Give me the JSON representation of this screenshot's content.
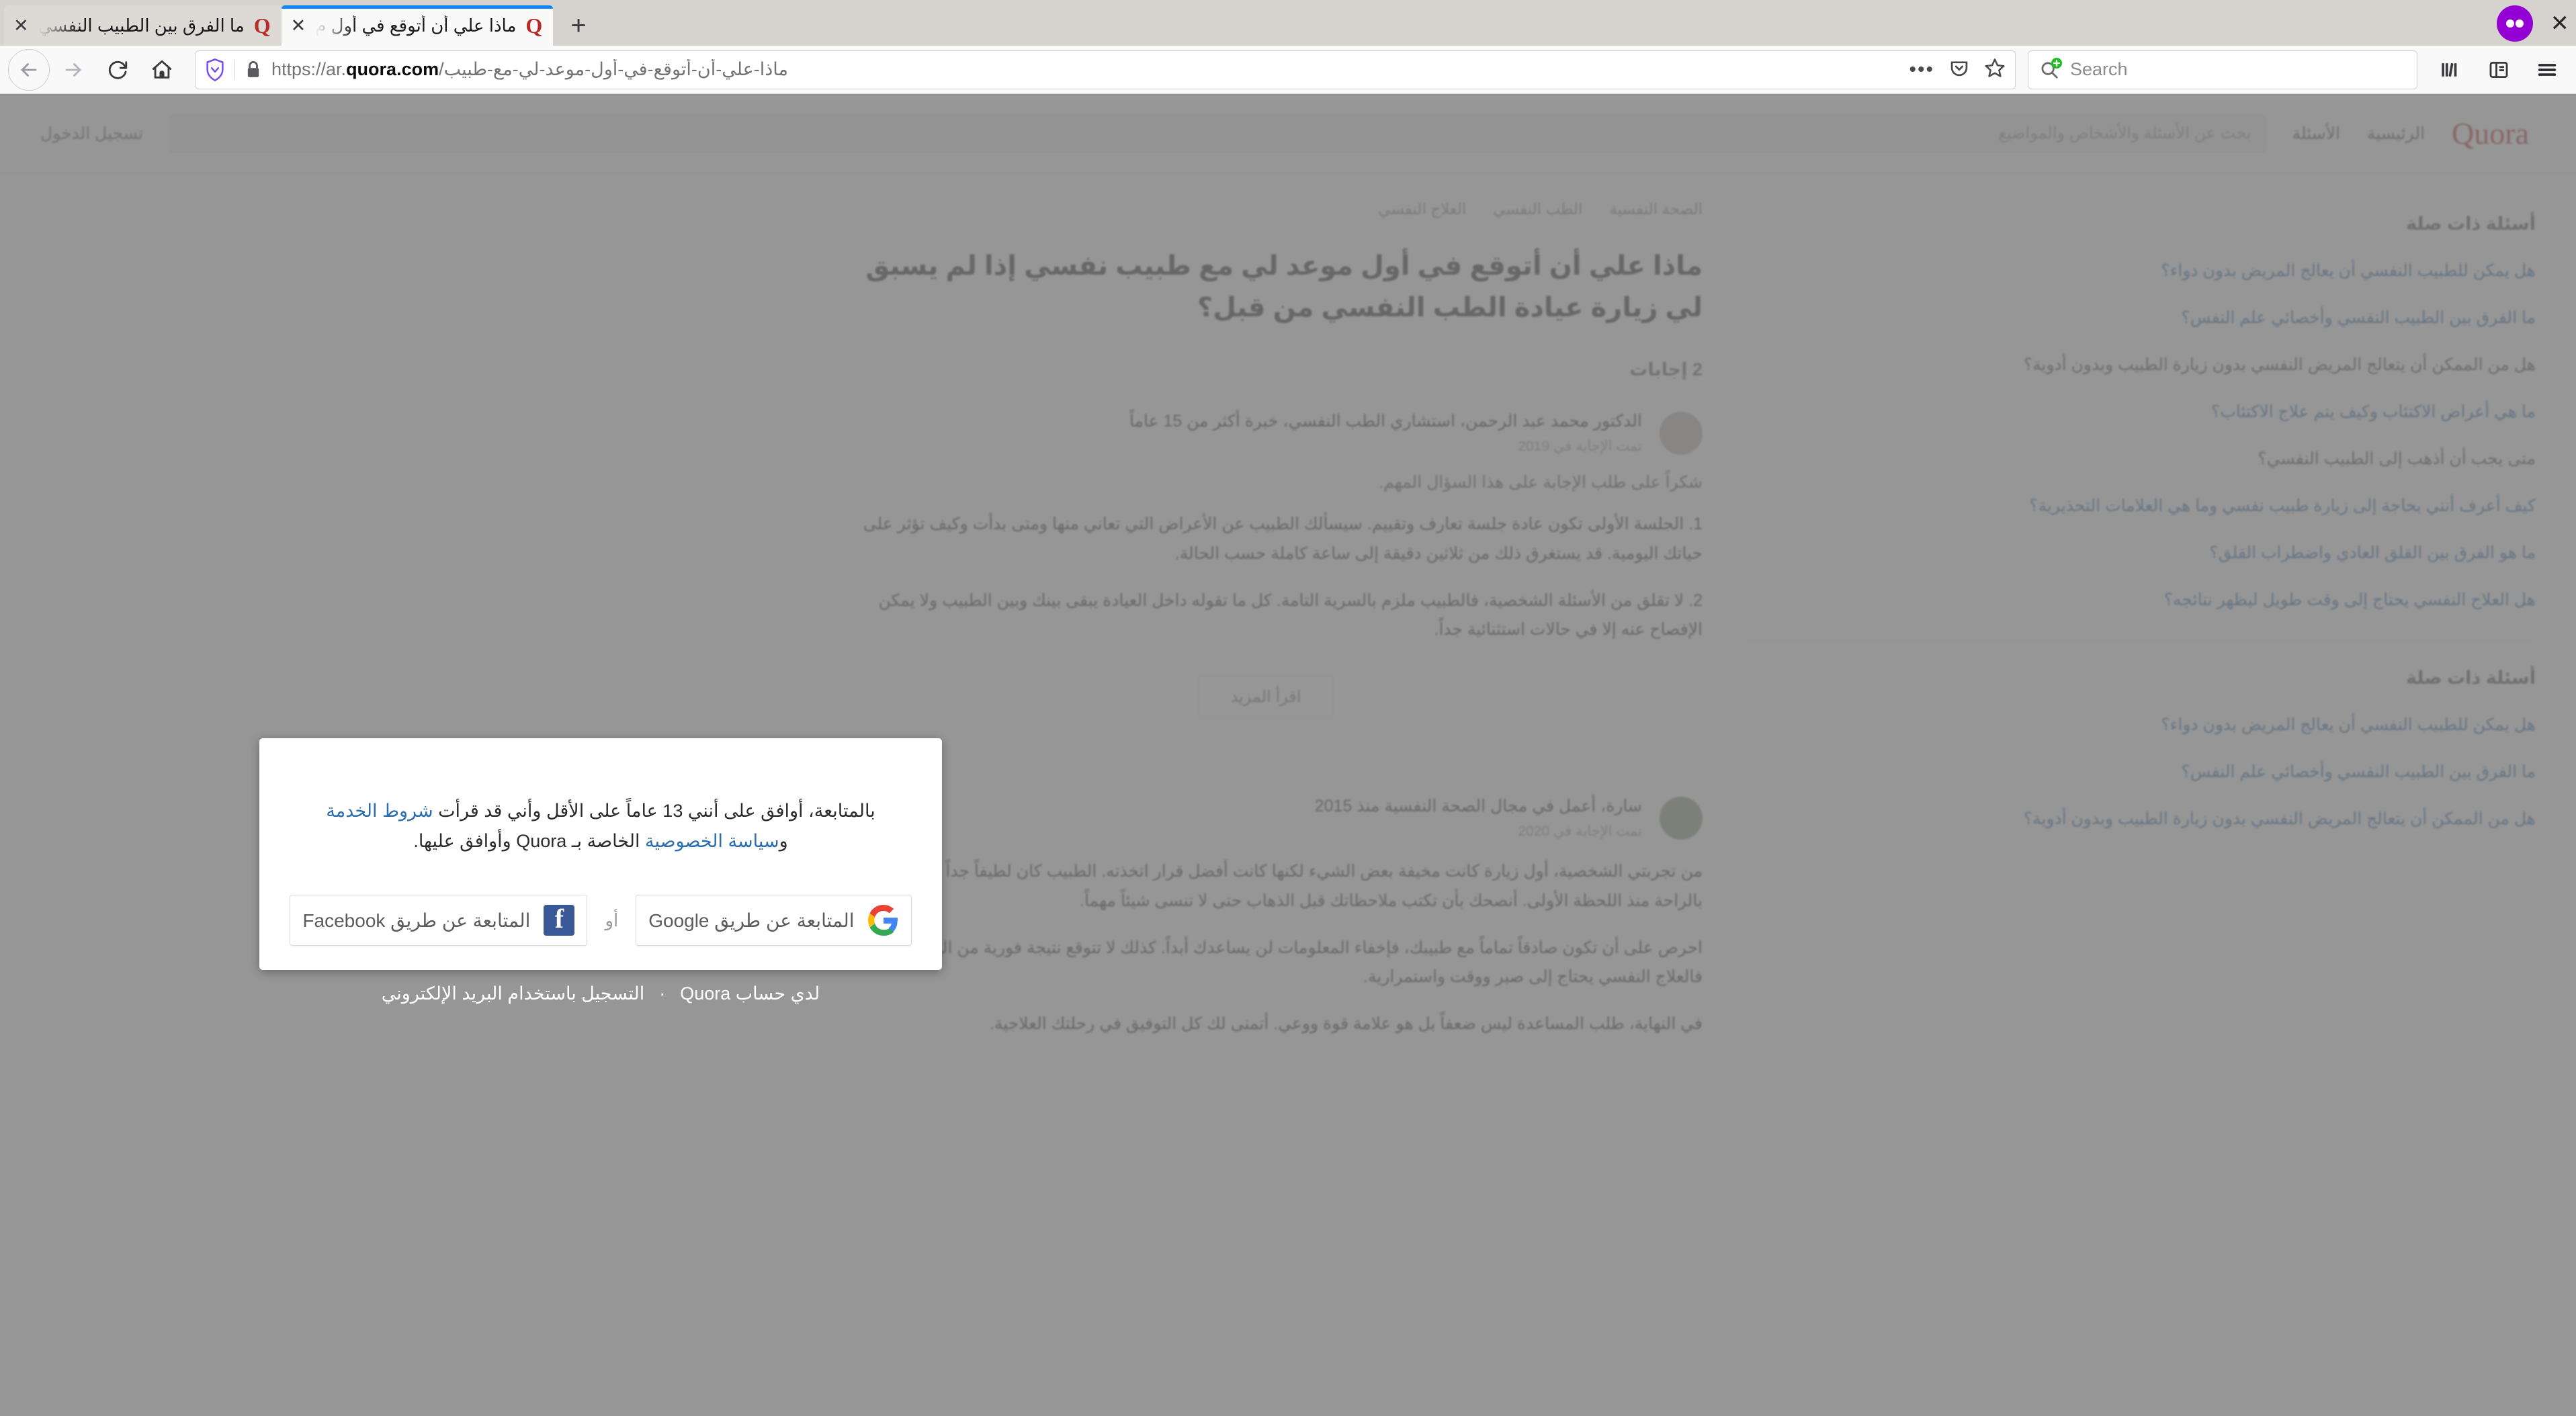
{
  "browser": {
    "tabs": [
      {
        "title": "ما الفرق بين الطبيب النفسي",
        "favicon": "quora-q-icon",
        "active": false,
        "close_label": "✕"
      },
      {
        "title": "ماذا علي أن أتوقع في أول م",
        "favicon": "quora-q-icon",
        "active": true,
        "close_label": "✕"
      }
    ],
    "new_tab_label": "+",
    "window_close_label": "✕",
    "private_badge_name": "private-browsing-mask-icon",
    "nav": {
      "back_label": "←",
      "forward_label": "→",
      "reload_label": "⟳",
      "home_label": "⌂"
    },
    "url": {
      "scheme": "https://ar.",
      "domain": "quora.com",
      "path": "/ماذا-علي-أن-أتوقع-في-أول-موعد-لي-مع-طبيب",
      "full": "https://ar.quora.com/ماذا-علي-أن-أتوقع-في-أول-موعد-لي-مع-طبيب",
      "shield_title": "tracking-protection-shield",
      "lock_title": "secure-connection-lock",
      "page_actions_label": "•••",
      "save_to_pocket_label": "pocket-icon",
      "bookmark_label": "★"
    },
    "search": {
      "placeholder": "Search",
      "engine_icon": "search-add-icon"
    },
    "toolbar": {
      "library_label": "library-icon",
      "sidebar_label": "sidebar-icon",
      "menu_label": "≡"
    }
  },
  "page": {
    "logo": "Quora",
    "header_nav": [
      "الرئيسية",
      "الأسئلة"
    ],
    "header_search_placeholder": "بحث عن الأسئلة والأشخاص والمواضيع",
    "header_signin": "تسجيل الدخول",
    "related": {
      "heading": "أسئلة ذات صلة",
      "questions": [
        "هل يمكن للطبيب النفسي أن يعالج المريض بدون دواء؟",
        "ما الفرق بين الطبيب النفسي وأخصائي علم النفس؟",
        "هل من الممكن أن يتعالج المريض النفسي بدون زيارة الطبيب وبدون أدوية؟",
        "ما هي أعراض الاكتئاب وكيف يتم علاج الاكتئاب؟",
        "متى يجب أن أذهب إلى الطبيب النفسي؟",
        "كيف أعرف أنني بحاجة إلى زيارة طبيب نفسي وما هي العلامات التحذيرية؟",
        "ما هو الفرق بين القلق العادي واضطراب القلق؟",
        "هل العلاج النفسي يحتاج إلى وقت طويل ليظهر نتائجه؟"
      ]
    },
    "related2": {
      "heading": "أسئلة ذات صلة",
      "questions": [
        "هل يمكن للطبيب النفسي أن يعالج المريض بدون دواء؟",
        "ما الفرق بين الطبيب النفسي وأخصائي علم النفس؟",
        "هل من الممكن أن يتعالج المريض النفسي بدون زيارة الطبيب وبدون أدوية؟"
      ]
    },
    "question": {
      "meta": [
        "الصحة النفسية",
        "الطب النفسي",
        "العلاج النفسي"
      ],
      "title": "ماذا علي أن أتوقع في أول موعد لي مع طبيب نفسي إذا لم يسبق لي زيارة عيادة الطب النفسي من قبل؟",
      "answer_count": "2 إجابات"
    },
    "answers": [
      {
        "author": "الدكتور محمد عبد الرحمن، استشاري الطب النفسي، خبرة أكثر من 15 عاماً",
        "author_sub": "تمت الإجابة في 2019",
        "lead": "شكراً على طلب الإجابة على هذا السؤال المهم.",
        "paragraphs": [
          "1. الجلسة الأولى تكون عادة جلسة تعارف وتقييم. سيسألك الطبيب عن الأعراض التي تعاني منها ومتى بدأت وكيف تؤثر على حياتك اليومية. قد يستغرق ذلك من ثلاثين دقيقة إلى ساعة كاملة حسب الحالة.",
          "2. لا تقلق من الأسئلة الشخصية، فالطبيب ملزم بالسرية التامة. كل ما تقوله داخل العيادة يبقى بينك وبين الطبيب ولا يمكن الإفصاح عنه إلا في حالات استثنائية جداً."
        ],
        "more_label": "اقرأ المزيد"
      },
      {
        "author": "سارة، أعمل في مجال الصحة النفسية منذ 2015",
        "author_sub": "تمت الإجابة في 2020",
        "lead": "",
        "paragraphs": [
          "من تجربتي الشخصية، أول زيارة كانت مخيفة بعض الشيء لكنها كانت أفضل قرار اتخذته. الطبيب كان لطيفاً جداً وجعلني أشعر بالراحة منذ اللحظة الأولى. أنصحك بأن تكتب ملاحظاتك قبل الذهاب حتى لا تنسى شيئاً مهماً.",
          "احرص على أن تكون صادقاً تماماً مع طبيبك، فإخفاء المعلومات لن يساعدك أبداً. كذلك لا تتوقع نتيجة فورية من الجلسة الأولى، فالعلاج النفسي يحتاج إلى صبر ووقت واستمرارية.",
          "في النهاية، طلب المساعدة ليس ضعفاً بل هو علامة قوة ووعي. أتمنى لك كل التوفيق في رحلتك العلاجية."
        ],
        "more_label": ""
      }
    ]
  },
  "modal": {
    "terms_prefix": "بالمتابعة، أوافق على أنني 13 عاماً على الأقل وأني قد قرأت ",
    "terms_link_1": "شروط الخدمة",
    "terms_mid": " و",
    "terms_link_2": "سياسة الخصوصية",
    "terms_suffix": " الخاصة بـ Quora وأوافق عليها.",
    "or_label": "أو",
    "google_button": "المتابعة عن طريق Google",
    "facebook_button": "المتابعة عن طريق Facebook",
    "google_icon": "google-g-icon",
    "facebook_icon": "facebook-f-icon"
  },
  "modal_footer": {
    "signup_email": "التسجيل باستخدام البريد الإلكتروني",
    "separator": "·",
    "have_account": "لدي حساب Quora"
  },
  "colors": {
    "quora_red": "#b92b27",
    "link_blue": "#2b6dad",
    "facebook_blue": "#3b5998",
    "active_tab_accent": "#0a84ff",
    "private_purple": "#9400d3",
    "overlay": "rgba(120,120,120,0.78)"
  }
}
